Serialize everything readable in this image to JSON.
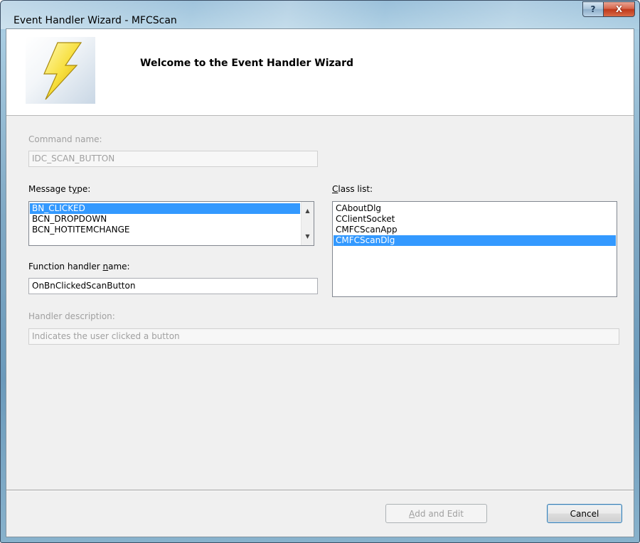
{
  "window": {
    "title": "Event Handler Wizard - MFCScan",
    "help_label": "?",
    "close_label": "X"
  },
  "banner": {
    "title": "Welcome to the Event Handler Wizard",
    "icon": "lightning-bolt-icon"
  },
  "command": {
    "label": "Command name:",
    "value": "IDC_SCAN_BUTTON"
  },
  "message_type": {
    "label_pre": "Message t",
    "label_mn": "y",
    "label_post": "pe:",
    "items": [
      "BN_CLICKED",
      "BCN_DROPDOWN",
      "BCN_HOTITEMCHANGE"
    ],
    "selected": "BN_CLICKED"
  },
  "class_list": {
    "label_pre": "",
    "label_mn": "C",
    "label_post": "lass list:",
    "items": [
      "CAboutDlg",
      "CClientSocket",
      "CMFCScanApp",
      "CMFCScanDlg"
    ],
    "selected": "CMFCScanDlg"
  },
  "function_handler": {
    "label_pre": "Function handler ",
    "label_mn": "n",
    "label_post": "ame:",
    "value": "OnBnClickedScanButton"
  },
  "handler_description": {
    "label": "Handler description:",
    "value": "Indicates the user clicked a button"
  },
  "buttons": {
    "add_edit_mn": "A",
    "add_edit_rest": "dd and Edit",
    "cancel": "Cancel"
  },
  "colors": {
    "selection": "#3399ff",
    "disabled_text": "#a0a0a0",
    "dialog_bg": "#f0f0f0"
  }
}
